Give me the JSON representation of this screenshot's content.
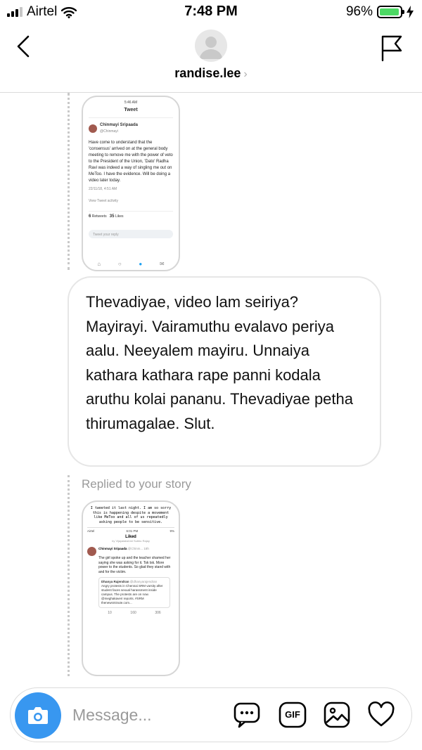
{
  "status_bar": {
    "carrier": "Airtel",
    "time": "7:48 PM",
    "battery_percent": "96%",
    "battery_level": 0.96
  },
  "header": {
    "username": "randise.lee",
    "chevron": "›",
    "icons": [
      "back-chevron-icon",
      "flag-icon"
    ]
  },
  "thread": {
    "tweet_screenshot_1": {
      "status_time": "5:46 AM",
      "screen_title": "Tweet",
      "author_name": "Chinmayi Sripaada",
      "author_handle": "@Chinmayi",
      "text": "Have come to understand that the 'consensus' arrived on at the general body meeting to remove me with the power of veto to the President of the Union, 'Dato' Radha Ravi was indeed a way of singling me out on MeToo. I have the evidence. Will be doing a video later today.",
      "timestamp": "22/11/18, 4:51 AM",
      "activity_label": "View Tweet activity",
      "retweets": "6",
      "retweets_label": "Retweets",
      "likes": "35",
      "likes_label": "Likes",
      "reply_placeholder": "Tweet your reply"
    },
    "message_text": "Thevadiyae, video lam seiriya? Mayirayi. Vairamuthu evalavo periya aalu. Neeyalem mayiru. Unnaiya kathara kathara rape panni kodala aruthu kolai pananu. Thevadiyae petha thirumagalae. Slut.",
    "replied_label": "Replied to your story",
    "tweet_screenshot_2": {
      "caption": "I tweeted it last night. I am so sorry this is happening despite a movement like MeToo and all of us repeatedly asking people to be sensitive.",
      "carrier": "Airtel",
      "time": "6:01 PM",
      "battery": "9%",
      "screen_title": "Liked",
      "screen_sub": "by Vijayalakshmi Subbu Rajay",
      "author_name": "Chinmayi Sripaada",
      "author_handle": "@Chinm...",
      "age": "18h",
      "text": "The girl spoke up and the teacher shamed her saying she was asking for it. Tsk tsk. More power to the students. So glad they stand with and for the victim.",
      "quote_author": "Dhanya Rajendran",
      "quote_handle": "@dhanyarajendran",
      "quote_text": "Angry protests in Chennai SRM varsity after student faces sexual harassment inside campus. The protests are on now. @meghakaveri reports. #SRM thenewsminute.com...",
      "replies": "10",
      "retweets": "160",
      "likes": "306"
    }
  },
  "composer": {
    "placeholder": "Message...",
    "gif_label": "GIF",
    "icons": [
      "camera-icon",
      "chat-bubble-icon",
      "gif-icon",
      "gallery-icon",
      "heart-icon"
    ]
  },
  "colors": {
    "accent": "#3897f0",
    "battery_fill": "#4cd964",
    "border": "#dbdbdb",
    "muted_text": "#9a9a9a"
  }
}
